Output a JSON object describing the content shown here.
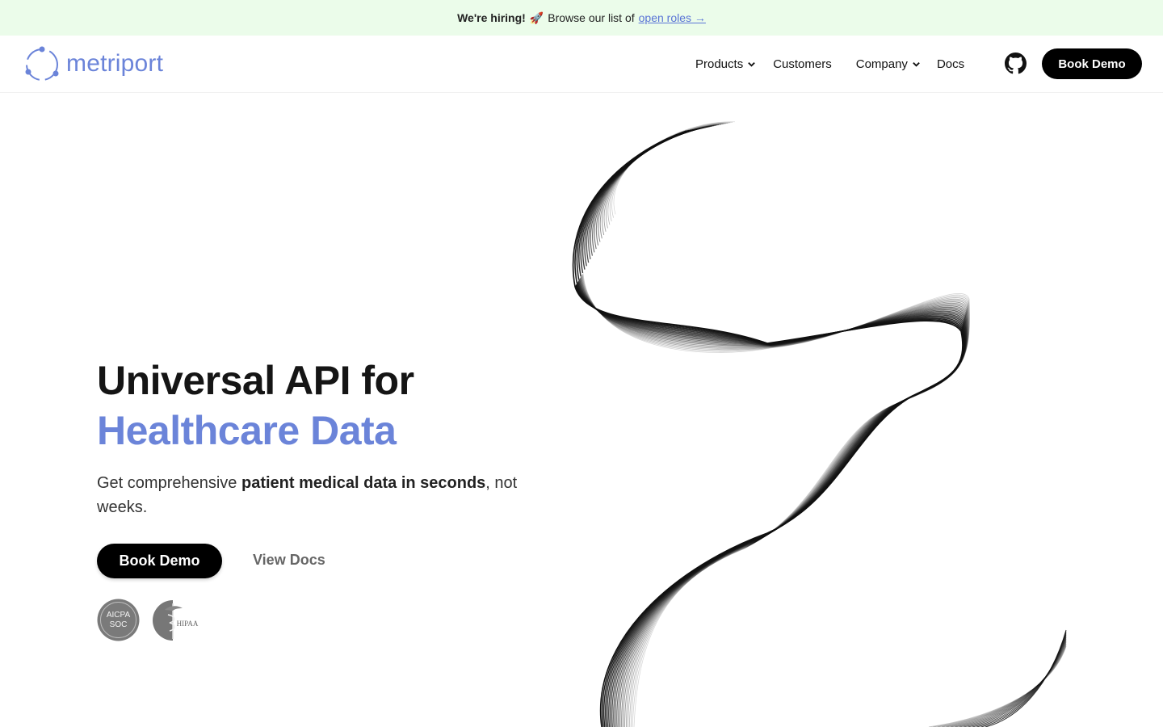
{
  "banner": {
    "bold_text": "We're hiring!",
    "emoji": "🚀",
    "text": "Browse our list of",
    "link": "open roles →"
  },
  "brand": {
    "name": "metriport",
    "accent_color": "#6b84d9"
  },
  "nav": {
    "items": [
      {
        "label": "Products",
        "has_dropdown": true
      },
      {
        "label": "Customers",
        "has_dropdown": false
      },
      {
        "label": "Company",
        "has_dropdown": true
      },
      {
        "label": "Docs",
        "has_dropdown": false
      }
    ],
    "github_icon": "github-icon",
    "cta": "Book Demo"
  },
  "hero": {
    "title_line1": "Universal API for",
    "title_line2": "Healthcare Data",
    "subtitle_pre": "Get comprehensive ",
    "subtitle_bold": "patient medical data in seconds",
    "subtitle_post": ", not weeks.",
    "primary_cta": "Book Demo",
    "secondary_cta": "View Docs"
  },
  "badges": {
    "soc_line1": "AICPA",
    "soc_line2": "SOC",
    "hipaa": "HIPAA"
  }
}
